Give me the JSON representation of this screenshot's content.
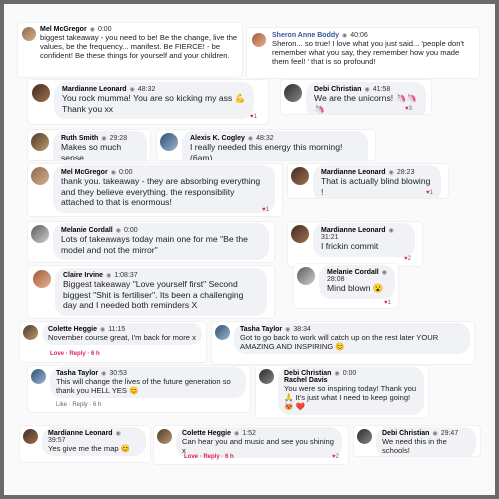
{
  "comments": [
    {
      "name": "Mel McGregor",
      "time": "0:00",
      "text": "biggest takeaway - you need to be! Be the change, live the values, be the frequency... manifest. Be FIERCE! - be confident! Be these things for yourself and your children."
    },
    {
      "name": "Sheron Anne Boddy",
      "time": "40:06",
      "text": "Sheron... so true! I love what you just said... 'people don't remember what you say, they remember how you made them feel! ' that is so profound!",
      "footer": "Like · Reply"
    },
    {
      "name": "Mardianne Leonard",
      "time": "48:32",
      "text": "You rock mumma! You are so kicking my ass 💪 Thank you xx",
      "actions": "Like · Reply · 6h",
      "reacts": "1"
    },
    {
      "name": "Debi Christian",
      "time": "41:58",
      "text": "We are the unicorns! 🦄🦄🦄",
      "reacts": "3"
    },
    {
      "name": "Ruth Smith",
      "time": "29:28",
      "text": "Makes so much sense"
    },
    {
      "name": "Alexis K. Cogley",
      "time": "48:32",
      "text": "I really needed this energy this morning! (6am)",
      "reacts": "1"
    },
    {
      "name": "Mel McGregor",
      "time": "0:00",
      "text": "thank you. takeaway - they are absorbing everything and they believe everything. the responsibility attached to that is enormous!",
      "reacts": "1"
    },
    {
      "name": "Mardianne Leonard",
      "time": "28:23",
      "text": "That is actually blind blowing !",
      "reacts": "1"
    },
    {
      "name": "Melanie Cordall",
      "time": "0:00",
      "text": "Lots of takeaways today main one for me \"Be the model and not the mirror\""
    },
    {
      "name": "Mardianne Leonard",
      "time": "31:21",
      "text": "I frickin commit",
      "reacts": "2"
    },
    {
      "name": "Claire Irvine",
      "time": "1:08:37",
      "text": "Biggest takeaway \"Love yourself first\" Second biggest \"Shit is fertiliser\". Its been a challenging day and I needed both reminders X"
    },
    {
      "name": "Melanie Cordall",
      "time": "28:08",
      "text": "Mind blown 😮",
      "reacts": "1"
    },
    {
      "name": "Colette Heggie",
      "time": "11:15",
      "text": "November course great, I'm back for more x",
      "actions": "Love · Reply · 6 h"
    },
    {
      "name": "Tasha Taylor",
      "time": "38:34",
      "text": "Got to go back to work will catch up on the rest later YOUR AMAZING AND INSPIRING 😊"
    },
    {
      "name": "Tasha Taylor",
      "time": "30:53",
      "text": "This will change the lives of the future generation so thank you HELL YES 😊",
      "actions": "Like · Reply · 6 h"
    },
    {
      "name": "Debi Christian",
      "time": "0:00",
      "subname": "Rachel Davis",
      "text": "You were so inspiring today! Thank you 🙏 It's just what I need to keep going! 😻 ❤️"
    },
    {
      "name": "Mardianne Leonard",
      "time": "39:57",
      "text": "Yes give me the map 😊"
    },
    {
      "name": "Colette Heggie",
      "time": "1:52",
      "text": "Can hear you and music and see you shining x",
      "actions": "Love · Reply · 6 h",
      "reacts": "2"
    },
    {
      "name": "Debi Christian",
      "time": "29:47",
      "text": "We need this in the schools!"
    }
  ]
}
